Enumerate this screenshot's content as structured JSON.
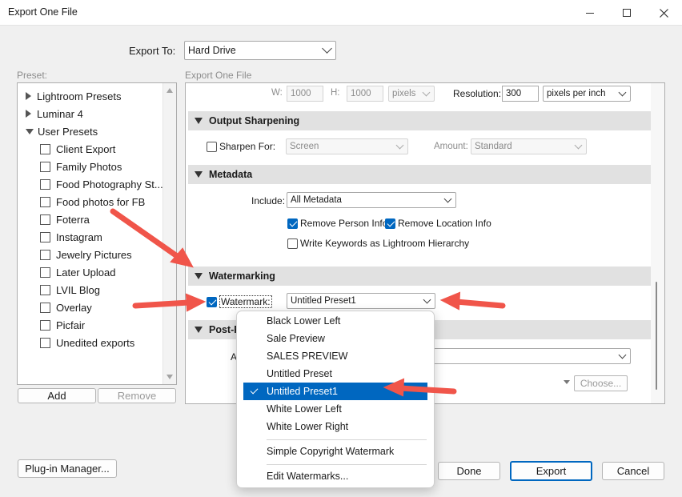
{
  "window": {
    "title": "Export One File"
  },
  "export_to": {
    "label": "Export To:",
    "value": "Hard Drive"
  },
  "preset_panel": {
    "label": "Preset:",
    "items": [
      {
        "label": "Lightroom Presets",
        "kind": "folder-collapsed"
      },
      {
        "label": "Luminar 4",
        "kind": "folder-collapsed"
      },
      {
        "label": "User Presets",
        "kind": "folder-expanded"
      },
      {
        "label": "Client Export",
        "kind": "preset"
      },
      {
        "label": "Family Photos",
        "kind": "preset"
      },
      {
        "label": "Food Photography St...",
        "kind": "preset"
      },
      {
        "label": "Food photos for FB",
        "kind": "preset"
      },
      {
        "label": "Foterra",
        "kind": "preset"
      },
      {
        "label": "Instagram",
        "kind": "preset"
      },
      {
        "label": "Jewelry Pictures",
        "kind": "preset"
      },
      {
        "label": "Later Upload",
        "kind": "preset"
      },
      {
        "label": "LVIL Blog",
        "kind": "preset"
      },
      {
        "label": "Overlay",
        "kind": "preset"
      },
      {
        "label": "Picfair",
        "kind": "preset"
      },
      {
        "label": "Unedited exports",
        "kind": "preset"
      }
    ],
    "add_label": "Add",
    "remove_label": "Remove"
  },
  "main_panel": {
    "label": "Export One File",
    "size_row": {
      "w_label": "W:",
      "w_value": "1000",
      "h_label": "H:",
      "h_value": "1000",
      "unit": "pixels",
      "resolution_label": "Resolution:",
      "resolution_value": "300",
      "resolution_unit": "pixels per inch"
    },
    "output_sharpening": {
      "header": "Output Sharpening",
      "sharpen_label": "Sharpen For:",
      "sharpen_checked": false,
      "sharpen_value": "Screen",
      "amount_label": "Amount:",
      "amount_value": "Standard"
    },
    "metadata": {
      "header": "Metadata",
      "include_label": "Include:",
      "include_value": "All Metadata",
      "remove_person_label": "Remove Person Info",
      "remove_person_checked": true,
      "remove_location_label": "Remove Location Info",
      "remove_location_checked": true,
      "write_keywords_label": "Write Keywords as Lightroom Hierarchy",
      "write_keywords_checked": false
    },
    "watermarking": {
      "header": "Watermarking",
      "watermark_label": "Watermark:",
      "watermark_checked": true,
      "watermark_value": "Untitled Preset1"
    },
    "post_processing": {
      "header_partial": "Post-P",
      "after_partial": "A",
      "choose_label": "Choose..."
    }
  },
  "watermark_menu": {
    "items": [
      {
        "label": "Black Lower Left"
      },
      {
        "label": "Sale Preview"
      },
      {
        "label": "SALES PREVIEW"
      },
      {
        "label": "Untitled Preset"
      },
      {
        "label": "Untitled Preset1",
        "selected": true
      },
      {
        "label": "White Lower Left"
      },
      {
        "label": "White Lower Right"
      },
      {
        "label": "Simple Copyright Watermark"
      },
      {
        "label": "Edit Watermarks..."
      }
    ]
  },
  "footer": {
    "plugin_manager_label": "Plug-in Manager...",
    "done_label": "Done",
    "export_label": "Export",
    "cancel_label": "Cancel"
  },
  "colors": {
    "accent": "#0067c0",
    "annotation_arrow": "#f0554a",
    "section_header_bg": "#e1e1e1"
  }
}
